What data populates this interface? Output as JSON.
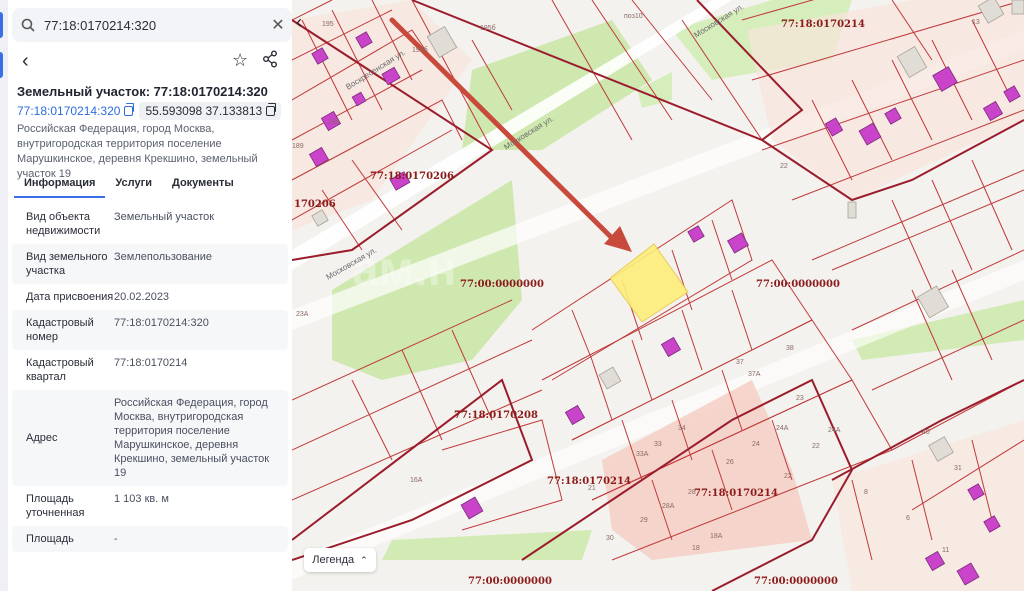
{
  "search": {
    "value": "77:18:0170214:320"
  },
  "panel": {
    "title": "Земельный участок: 77:18:0170214:320",
    "cadastral_link": "77:18:0170214:320",
    "coordinates": "55.593098 37.133813",
    "address": "Российская Федерация, город Москва, внутригородская территория поселение Марушкинское, деревня Крекшино, земельный участок 19"
  },
  "tabs": [
    "Информация",
    "Услуги",
    "Документы"
  ],
  "info_rows": [
    {
      "key": "Вид объекта недвижимости",
      "value": "Земельный участок"
    },
    {
      "key": "Вид земельного участка",
      "value": "Землепользование"
    },
    {
      "key": "Дата присвоения",
      "value": "20.02.2023"
    },
    {
      "key": "Кадастровый номер",
      "value": "77:18:0170214:320"
    },
    {
      "key": "Кадастровый квартал",
      "value": "77:18:0170214"
    },
    {
      "key": "Адрес",
      "value": "Российская Федерация, город Москва, внутригородская территория поселение Марушкинское, деревня Крекшино, земельный участок 19"
    },
    {
      "key": "Площадь уточненная",
      "value": "1 103 кв. м"
    },
    {
      "key": "Площадь",
      "value": "-"
    }
  ],
  "map": {
    "legend_label": "Легенда",
    "labels": {
      "q0214_top": "77:18:0170214",
      "q0206": "77:18:0170206",
      "q0206_left": "170206",
      "z1": "77:00:0000000",
      "z2": "77:00:0000000",
      "q0208": "77:18:0170208",
      "q0214_a": "77:18:0170214",
      "q0214_b": "77:18:0170214",
      "z3": "77:00:0000000",
      "z4": "77:00:0000000"
    },
    "streets": {
      "s1": "Московская ул.",
      "s2": "Московская ул.",
      "s3": "Московская ул.",
      "s4": "Воскресенская ул."
    },
    "numbers": {
      "n1": "195б",
      "n2": "195",
      "n3": "194б",
      "n4": "186",
      "n5": "189",
      "n6": "13",
      "n7": "22",
      "n8": "37",
      "n9": "37A",
      "n10": "38",
      "n11": "23",
      "n12": "24A",
      "n13": "24",
      "n14": "26",
      "n15": "22",
      "n16": "34",
      "n17": "33",
      "n18": "33A",
      "n19": "28",
      "n20": "28A",
      "n21": "29",
      "n22": "18",
      "n23": "18A",
      "n24": "16A",
      "n25": "8",
      "n26": "31",
      "n27": "21",
      "n28": "30",
      "n29": "6",
      "n30": "11",
      "n31": "40",
      "n32": "22",
      "n33": "поз10",
      "n34": "24A",
      "n35": "23A"
    },
    "watermark": "ам.н"
  },
  "colors": {
    "accent": "#3b6fe6",
    "link": "#2d6cdf",
    "parcel_line": "#c0393b",
    "quarter_line": "#9b1c2c",
    "highlight": "#fdee7a",
    "building": "#c944c9",
    "arrow": "#c84a3c",
    "green": "#cfe8b0"
  }
}
